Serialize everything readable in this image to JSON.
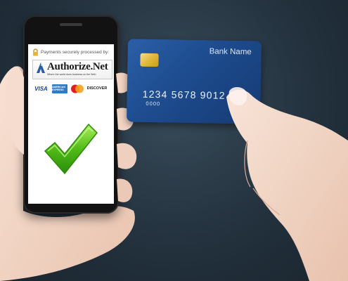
{
  "phone": {
    "processed_text": "Payments securely processed by:",
    "brand": "Authorize.Net",
    "tagline": "Where the world does business on the Web",
    "card_brands": [
      "VISA",
      "AMERICAN EXPRESS",
      "MasterCard",
      "DISCOVER"
    ]
  },
  "card": {
    "bank_name": "Bank Name",
    "number": "1234  5678  9012  3",
    "sub_number": "0000"
  },
  "colors": {
    "background": "#23323e",
    "card_blue": "#1e4d90",
    "check_green": "#5dbb1f",
    "skin": "#f3d6c6"
  },
  "icons": [
    "lock-icon",
    "authorize-logo-icon",
    "checkmark-icon",
    "chip-icon"
  ]
}
